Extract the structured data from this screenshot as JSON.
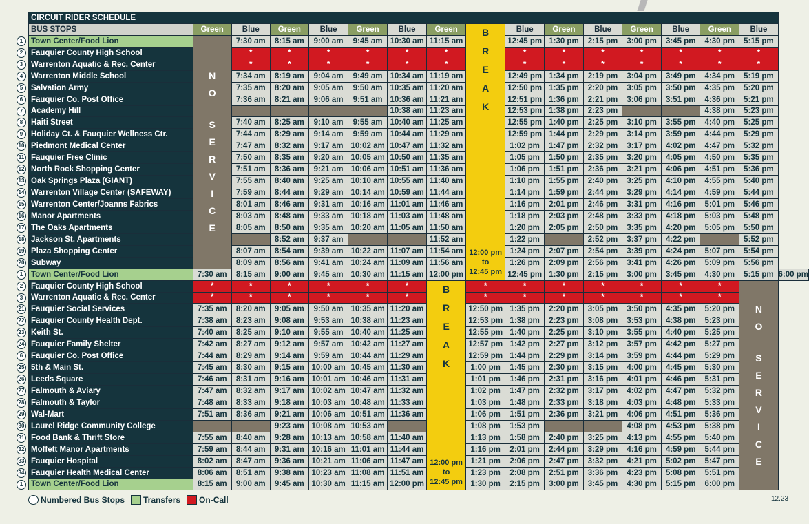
{
  "title": "CIRCUIT RIDER SCHEDULE",
  "bus_stops_label": "BUS STOPS",
  "route_colors": [
    "Green",
    "Blue",
    "Green",
    "Blue",
    "Green",
    "Blue",
    "Green",
    "",
    "Blue",
    "Green",
    "Blue",
    "Green",
    "Blue",
    "Green",
    "Blue"
  ],
  "no_service_letters": [
    "N",
    "O",
    "S",
    "E",
    "R",
    "V",
    "I",
    "C",
    "E"
  ],
  "break_letters": [
    "B",
    "R",
    "E",
    "A",
    "K"
  ],
  "break_time": [
    "12:00 pm",
    "to",
    "12:45 pm"
  ],
  "legend": {
    "numbered": "Numbered Bus Stops",
    "transfers": "Transfers",
    "oncall": "On-Call"
  },
  "version": "12.23",
  "rows": [
    {
      "n": "1",
      "stop": "Town Center/Food Lion",
      "tr": true,
      "t1": [
        "7:30 am",
        "8:15 am",
        "9:00 am",
        "9:45 am",
        "10:30 am",
        "11:15 am"
      ],
      "t2": [
        "12:45 pm",
        "1:30 pm",
        "2:15 pm",
        "3:00 pm",
        "3:45 pm",
        "4:30 pm",
        "5:15 pm"
      ]
    },
    {
      "n": "2",
      "stop": "Fauquier County High School",
      "t1": [
        "*",
        "*",
        "*",
        "*",
        "*",
        "*"
      ],
      "t2": [
        "*",
        "*",
        "*",
        "*",
        "*",
        "*",
        "*"
      ]
    },
    {
      "n": "3",
      "stop": "Warrenton Aquatic & Rec. Center",
      "t1": [
        "*",
        "*",
        "*",
        "*",
        "*",
        "*"
      ],
      "t2": [
        "*",
        "*",
        "*",
        "*",
        "*",
        "*",
        "*"
      ]
    },
    {
      "n": "4",
      "stop": "Warrenton Middle School",
      "t1": [
        "7:34 am",
        "8:19 am",
        "9:04 am",
        "9:49 am",
        "10:34 am",
        "11:19 am"
      ],
      "t2": [
        "12:49 pm",
        "1:34 pm",
        "2:19 pm",
        "3:04 pm",
        "3:49 pm",
        "4:34 pm",
        "5:19 pm"
      ]
    },
    {
      "n": "5",
      "stop": "Salvation Army",
      "t1": [
        "7:35 am",
        "8:20 am",
        "9:05 am",
        "9:50 am",
        "10:35 am",
        "11:20 am"
      ],
      "t2": [
        "12:50 pm",
        "1:35 pm",
        "2:20 pm",
        "3:05 pm",
        "3:50 pm",
        "4:35 pm",
        "5:20 pm"
      ]
    },
    {
      "n": "6",
      "stop": "Fauquier Co. Post Office",
      "t1": [
        "7:36 am",
        "8:21 am",
        "9:06 am",
        "9:51 am",
        "10:36 am",
        "11:21 am"
      ],
      "t2": [
        "12:51 pm",
        "1:36 pm",
        "2:21 pm",
        "3:06 pm",
        "3:51 pm",
        "4:36 pm",
        "5:21 pm"
      ]
    },
    {
      "n": "7",
      "stop": "Academy Hill",
      "t1": [
        "",
        "",
        "",
        "",
        "10:38 am",
        "11:23 am"
      ],
      "t2": [
        "12:53 pm",
        "1:38 pm",
        "2:23 pm",
        "",
        "",
        "4:38 pm",
        "5:23 pm"
      ]
    },
    {
      "n": "8",
      "stop": "Haiti Street",
      "t1": [
        "7:40 am",
        "8:25 am",
        "9:10 am",
        "9:55 am",
        "10:40 am",
        "11:25 am"
      ],
      "t2": [
        "12:55 pm",
        "1:40 pm",
        "2:25 pm",
        "3:10 pm",
        "3:55 pm",
        "4:40 pm",
        "5:25 pm"
      ]
    },
    {
      "n": "9",
      "stop": "Holiday Ct. & Fauquier Wellness Ctr.",
      "t1": [
        "7:44 am",
        "8:29 am",
        "9:14 am",
        "9:59 am",
        "10:44 am",
        "11:29 am"
      ],
      "t2": [
        "12:59 pm",
        "1:44 pm",
        "2:29 pm",
        "3:14 pm",
        "3:59 pm",
        "4:44 pm",
        "5:29 pm"
      ]
    },
    {
      "n": "10",
      "stop": "Piedmont Medical Center",
      "t1": [
        "7:47 am",
        "8:32 am",
        "9:17 am",
        "10:02 am",
        "10:47 am",
        "11:32 am"
      ],
      "t2": [
        "1:02 pm",
        "1:47 pm",
        "2:32 pm",
        "3:17 pm",
        "4:02 pm",
        "4:47 pm",
        "5:32 pm"
      ]
    },
    {
      "n": "11",
      "stop": "Fauquier Free Clinic",
      "t1": [
        "7:50 am",
        "8:35 am",
        "9:20 am",
        "10:05 am",
        "10:50 am",
        "11:35 am"
      ],
      "t2": [
        "1:05 pm",
        "1:50 pm",
        "2:35 pm",
        "3:20 pm",
        "4:05 pm",
        "4:50 pm",
        "5:35 pm"
      ]
    },
    {
      "n": "12",
      "stop": "North Rock Shopping Center",
      "t1": [
        "7:51 am",
        "8:36 am",
        "9:21 am",
        "10:06 am",
        "10:51 am",
        "11:36 am"
      ],
      "t2": [
        "1:06 pm",
        "1:51 pm",
        "2:36 pm",
        "3:21 pm",
        "4:06 pm",
        "4:51 pm",
        "5:36 pm"
      ]
    },
    {
      "n": "13",
      "stop": "Oak Springs Plaza (GIANT)",
      "t1": [
        "7:55 am",
        "8:40 am",
        "9:25 am",
        "10:10 am",
        "10:55 am",
        "11:40 am"
      ],
      "t2": [
        "1:10 pm",
        "1:55 pm",
        "2:40 pm",
        "3:25 pm",
        "4:10 pm",
        "4:55 pm",
        "5:40 pm"
      ]
    },
    {
      "n": "14",
      "stop": "Warrenton Village Center (SAFEWAY)",
      "t1": [
        "7:59 am",
        "8:44 am",
        "9:29 am",
        "10:14 am",
        "10:59 am",
        "11:44 am"
      ],
      "t2": [
        "1:14 pm",
        "1:59 pm",
        "2:44 pm",
        "3:29 pm",
        "4:14 pm",
        "4:59 pm",
        "5:44 pm"
      ]
    },
    {
      "n": "15",
      "stop": "Warrenton Center/Joanns Fabrics",
      "t1": [
        "8:01 am",
        "8:46 am",
        "9:31 am",
        "10:16 am",
        "11:01 am",
        "11:46 am"
      ],
      "t2": [
        "1:16 pm",
        "2:01 pm",
        "2:46 pm",
        "3:31 pm",
        "4:16 pm",
        "5:01 pm",
        "5:46 pm"
      ]
    },
    {
      "n": "16",
      "stop": "Manor Apartments",
      "t1": [
        "8:03 am",
        "8:48 am",
        "9:33 am",
        "10:18 am",
        "11:03 am",
        "11:48 am"
      ],
      "t2": [
        "1:18 pm",
        "2:03 pm",
        "2:48 pm",
        "3:33 pm",
        "4:18 pm",
        "5:03 pm",
        "5:48 pm"
      ]
    },
    {
      "n": "17",
      "stop": "The Oaks Apartments",
      "t1": [
        "8:05 am",
        "8:50 am",
        "9:35 am",
        "10:20 am",
        "11:05 am",
        "11:50 am"
      ],
      "t2": [
        "1:20 pm",
        "2:05 pm",
        "2:50 pm",
        "3:35 pm",
        "4:20 pm",
        "5:05 pm",
        "5:50 pm"
      ]
    },
    {
      "n": "18",
      "stop": "Jackson St. Apartments",
      "t1": [
        "",
        "8:52 am",
        "9:37 am",
        "",
        "",
        "11:52 am"
      ],
      "t2": [
        "1:22 pm",
        "",
        "2:52 pm",
        "3:37 pm",
        "4:22 pm",
        "",
        "5:52 pm"
      ]
    },
    {
      "n": "19",
      "stop": "Plaza Shopping Center",
      "t1": [
        "8:07 am",
        "8:54 am",
        "9:39 am",
        "10:22 am",
        "11:07 am",
        "11:54 am"
      ],
      "t2": [
        "1:24 pm",
        "2:07 pm",
        "2:54 pm",
        "3:39 pm",
        "4:24 pm",
        "5:07 pm",
        "5:54 pm"
      ]
    },
    {
      "n": "20",
      "stop": "Subway",
      "t1": [
        "8:09 am",
        "8:56 am",
        "9:41 am",
        "10:24 am",
        "11:09 am",
        "11:56 am"
      ],
      "t2": [
        "1:26 pm",
        "2:09 pm",
        "2:56 pm",
        "3:41 pm",
        "4:26 pm",
        "5:09 pm",
        "5:56 pm"
      ]
    },
    {
      "n": "1",
      "stop": "Town Center/Food Lion",
      "tr": true,
      "mid": true,
      "t1": [
        "7:30 am",
        "8:15 am",
        "9:00 am",
        "9:45 am",
        "10:30 am",
        "11:15 am",
        "12:00 pm"
      ],
      "t2": [
        "12:45 pm",
        "1:30 pm",
        "2:15 pm",
        "3:00 pm",
        "3:45 pm",
        "4:30 pm",
        "5:15 pm",
        "6:00 pm"
      ]
    },
    {
      "n": "2",
      "stop": "Fauquier County High School",
      "t1": [
        "*",
        "*",
        "*",
        "*",
        "*",
        "*"
      ],
      "t2": [
        "*",
        "*",
        "*",
        "*",
        "*",
        "*",
        "*"
      ]
    },
    {
      "n": "3",
      "stop": "Warrenton Aquatic & Rec. Center",
      "t1": [
        "*",
        "*",
        "*",
        "*",
        "*",
        "*"
      ],
      "t2": [
        "*",
        "*",
        "*",
        "*",
        "*",
        "*",
        "*"
      ]
    },
    {
      "n": "21",
      "stop": "Fauquier Social Services",
      "t1": [
        "7:35 am",
        "8:20 am",
        "9:05 am",
        "9:50 am",
        "10:35 am",
        "11:20 am"
      ],
      "t2": [
        "12:50 pm",
        "1:35 pm",
        "2:20 pm",
        "3:05 pm",
        "3:50 pm",
        "4:35 pm",
        "5:20 pm"
      ]
    },
    {
      "n": "22",
      "stop": "Fauquier County Health Dept.",
      "t1": [
        "7:38 am",
        "8:23 am",
        "9:08 am",
        "9:53 am",
        "10:38 am",
        "11:23 am"
      ],
      "t2": [
        "12:53 pm",
        "1:38 pm",
        "2:23 pm",
        "3:08 pm",
        "3:53 pm",
        "4:38 pm",
        "5:23 pm"
      ]
    },
    {
      "n": "23",
      "stop": "Keith St.",
      "t1": [
        "7:40 am",
        "8:25 am",
        "9:10 am",
        "9:55 am",
        "10:40 am",
        "11:25 am"
      ],
      "t2": [
        "12:55 pm",
        "1:40 pm",
        "2:25 pm",
        "3:10 pm",
        "3:55 pm",
        "4:40 pm",
        "5:25 pm"
      ]
    },
    {
      "n": "24",
      "stop": "Fauquier Family Shelter",
      "t1": [
        "7:42 am",
        "8:27 am",
        "9:12 am",
        "9:57 am",
        "10:42 am",
        "11:27 am"
      ],
      "t2": [
        "12:57 pm",
        "1:42 pm",
        "2:27 pm",
        "3:12 pm",
        "3:57 pm",
        "4:42 pm",
        "5:27 pm"
      ]
    },
    {
      "n": "6",
      "stop": "Fauquier Co. Post Office",
      "t1": [
        "7:44 am",
        "8:29 am",
        "9:14 am",
        "9:59 am",
        "10:44 am",
        "11:29 am"
      ],
      "t2": [
        "12:59 pm",
        "1:44 pm",
        "2:29 pm",
        "3:14 pm",
        "3:59 pm",
        "4:44 pm",
        "5:29 pm"
      ]
    },
    {
      "n": "25",
      "stop": "5th & Main St.",
      "t1": [
        "7:45 am",
        "8:30 am",
        "9:15 am",
        "10:00 am",
        "10:45 am",
        "11:30 am"
      ],
      "t2": [
        "1:00 pm",
        "1:45 pm",
        "2:30 pm",
        "3:15 pm",
        "4:00 pm",
        "4:45 pm",
        "5:30 pm"
      ]
    },
    {
      "n": "26",
      "stop": "Leeds Square",
      "t1": [
        "7:46 am",
        "8:31 am",
        "9:16 am",
        "10:01 am",
        "10:46 am",
        "11:31 am"
      ],
      "t2": [
        "1:01 pm",
        "1:46 pm",
        "2:31 pm",
        "3:16 pm",
        "4:01 pm",
        "4:46 pm",
        "5:31 pm"
      ]
    },
    {
      "n": "27",
      "stop": "Falmouth & Aviary",
      "t1": [
        "7:47 am",
        "8:32 am",
        "9:17 am",
        "10:02 am",
        "10:47 am",
        "11:32 am"
      ],
      "t2": [
        "1:02 pm",
        "1:47 pm",
        "2:32 pm",
        "3:17 pm",
        "4:02 pm",
        "4:47 pm",
        "5:32 pm"
      ]
    },
    {
      "n": "28",
      "stop": "Falmouth & Taylor",
      "t1": [
        "7:48 am",
        "8:33 am",
        "9:18 am",
        "10:03 am",
        "10:48 am",
        "11:33 am"
      ],
      "t2": [
        "1:03 pm",
        "1:48 pm",
        "2:33 pm",
        "3:18 pm",
        "4:03 pm",
        "4:48 pm",
        "5:33 pm"
      ]
    },
    {
      "n": "29",
      "stop": "Wal-Mart",
      "t1": [
        "7:51 am",
        "8:36 am",
        "9:21 am",
        "10:06 am",
        "10:51 am",
        "11:36 am"
      ],
      "t2": [
        "1:06 pm",
        "1:51 pm",
        "2:36 pm",
        "3:21 pm",
        "4:06 pm",
        "4:51 pm",
        "5:36 pm"
      ]
    },
    {
      "n": "30",
      "stop": "Laurel Ridge Community College",
      "t1": [
        "",
        "",
        "9:23 am",
        "10:08 am",
        "10:53 am",
        ""
      ],
      "t2": [
        "1:08 pm",
        "1:53 pm",
        "",
        "",
        "4:08 pm",
        "4:53 pm",
        "5:38 pm"
      ]
    },
    {
      "n": "31",
      "stop": "Food Bank & Thrift Store",
      "t1": [
        "7:55 am",
        "8:40 am",
        "9:28 am",
        "10:13 am",
        "10:58 am",
        "11:40 am"
      ],
      "t2": [
        "1:13 pm",
        "1:58 pm",
        "2:40 pm",
        "3:25 pm",
        "4:13 pm",
        "4:55 pm",
        "5:40 pm"
      ]
    },
    {
      "n": "32",
      "stop": "Moffett Manor Apartments",
      "t1": [
        "7:59 am",
        "8:44 am",
        "9:31 am",
        "10:16 am",
        "11:01 am",
        "11:44 am"
      ],
      "t2": [
        "1:16 pm",
        "2:01 pm",
        "2:44 pm",
        "3:29 pm",
        "4:16 pm",
        "4:59 pm",
        "5:44 pm"
      ]
    },
    {
      "n": "33",
      "stop": "Fauquier Hospital",
      "t1": [
        "8:02 am",
        "8:47 am",
        "9:36 am",
        "10:21 am",
        "11:06 am",
        "11:47 am"
      ],
      "t2": [
        "1:21 pm",
        "2:06 pm",
        "2:47 pm",
        "3:32 pm",
        "4:21 pm",
        "5:02 pm",
        "5:47 pm"
      ]
    },
    {
      "n": "34",
      "stop": "Fauquier Health Medical Center",
      "t1": [
        "8:06 am",
        "8:51 am",
        "9:38 am",
        "10:23 am",
        "11:08 am",
        "11:51 am"
      ],
      "t2": [
        "1:23 pm",
        "2:08 pm",
        "2:51 pm",
        "3:36 pm",
        "4:23 pm",
        "5:08 pm",
        "5:51 pm"
      ]
    },
    {
      "n": "1",
      "stop": "Town Center/Food Lion",
      "tr": true,
      "t1": [
        "8:15 am",
        "9:00 am",
        "9:45 am",
        "10:30 am",
        "11:15 am",
        "12:00 pm"
      ],
      "t2": [
        "1:30 pm",
        "2:15 pm",
        "3:00 pm",
        "3:45 pm",
        "4:30 pm",
        "5:15 pm",
        "6:00 pm"
      ]
    }
  ]
}
